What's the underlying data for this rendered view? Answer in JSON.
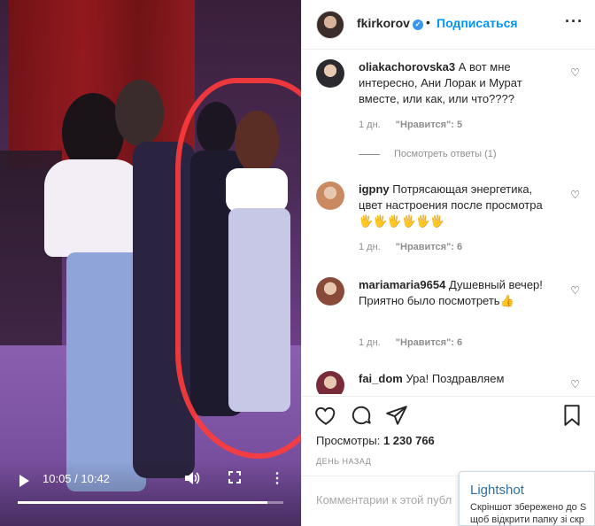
{
  "video": {
    "time_label": "10:05 / 10:42",
    "progress": 0.94,
    "volume_icon": "volume-icon",
    "more_icon": "⋮"
  },
  "post": {
    "username": "fkirkorov",
    "follow_label": "Подписаться",
    "more_label": "···",
    "views_label": "Просмотры:",
    "views_count": "1 230 766",
    "posted_ago": "ДЕНЬ НАЗАД"
  },
  "comments": [
    {
      "user": "oliakachorovska3",
      "text": "А вот мне интересно, Ани Лорак и Мурат вместе, или как, или что????",
      "age": "1 дн.",
      "likes": "\"Нравится\": 5",
      "replies": "Посмотреть ответы (1)",
      "avatar_color": "#2c2a2f"
    },
    {
      "user": "igpny",
      "text": "Потрясающая энергетика, цвет настроения после просмотра 🖐🖐🖐🖐🖐🖐",
      "age": "1 дн.",
      "likes": "\"Нравится\": 6",
      "avatar_color": "#c98a62"
    },
    {
      "user": "mariamaria9654",
      "text": "Душевный вечер! Приятно было посмотреть👍",
      "age": "1 дн.",
      "likes": "\"Нравится\": 6",
      "avatar_color": "#8a4a3a"
    },
    {
      "user": "fai_dom",
      "text": "Ура! Поздравляем",
      "avatar_color": "#7a2b3a"
    }
  ],
  "composer": {
    "placeholder": "Комментарии к этой публ"
  },
  "lightshot": {
    "title": "Lightshot",
    "line1": "Скріншот збережено до S",
    "line2": "щоб відкрити папку зі скр"
  }
}
